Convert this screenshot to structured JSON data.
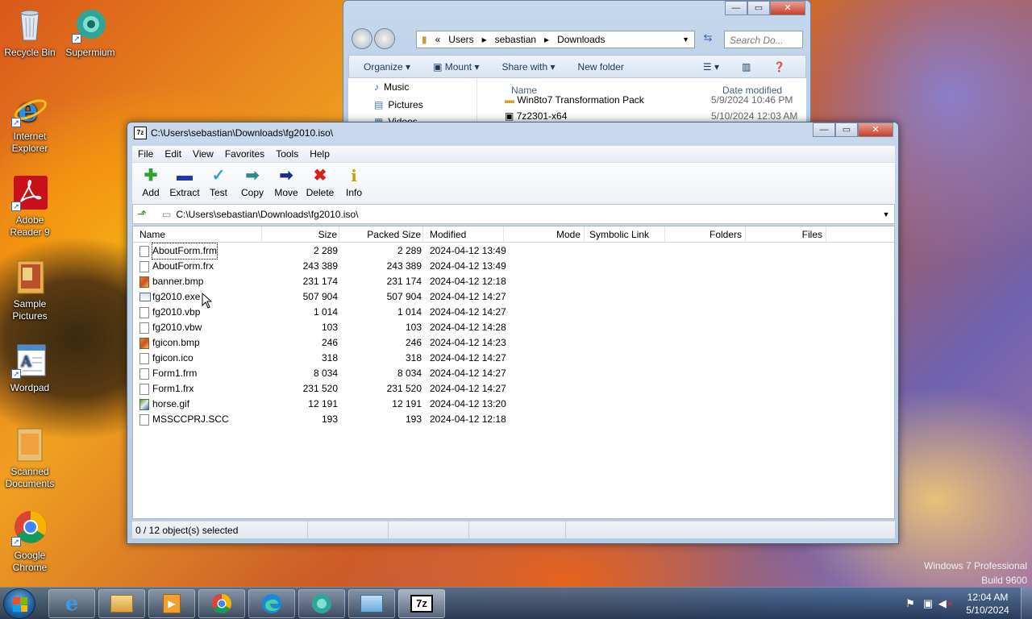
{
  "desktop": {
    "icons": [
      {
        "label": "Recycle Bin"
      },
      {
        "label": "Supermium"
      },
      {
        "label": "Internet Explorer"
      },
      {
        "label": "Adobe Reader 9"
      },
      {
        "label": "Sample Pictures"
      },
      {
        "label": "Wordpad"
      },
      {
        "label": "Scanned Documents"
      },
      {
        "label": "Google Chrome"
      }
    ],
    "watermark": {
      "line1": "Windows 7 Professional",
      "line2": "Build 9600"
    }
  },
  "explorer": {
    "address": {
      "part1": "Users",
      "part2": "sebastian",
      "part3": "Downloads",
      "prefix": "«"
    },
    "search_placeholder": "Search Do...",
    "toolbar": {
      "organize": "Organize",
      "mount": "Mount",
      "share": "Share with",
      "new_folder": "New folder"
    },
    "nav": [
      {
        "label": "Music"
      },
      {
        "label": "Pictures"
      },
      {
        "label": "Videos"
      }
    ],
    "columns": {
      "name": "Name",
      "date": "Date modified"
    },
    "rows": [
      {
        "name": "Win8to7 Transformation Pack",
        "date": "5/9/2024 10:46 PM"
      },
      {
        "name": "7z2301-x64",
        "date": "5/10/2024 12:03 AM"
      }
    ]
  },
  "zip": {
    "title": "C:\\Users\\sebastian\\Downloads\\fg2010.iso\\",
    "logo": "7z",
    "menu": [
      "File",
      "Edit",
      "View",
      "Favorites",
      "Tools",
      "Help"
    ],
    "toolbar": [
      {
        "label": "Add",
        "icon": "add-icon",
        "color": "#2aa52a"
      },
      {
        "label": "Extract",
        "icon": "extract-icon",
        "color": "#1a3aa8"
      },
      {
        "label": "Test",
        "icon": "test-icon",
        "color": "#2aa5c8"
      },
      {
        "label": "Copy",
        "icon": "copy-icon",
        "color": "#2a8a8a"
      },
      {
        "label": "Move",
        "icon": "move-icon",
        "color": "#1a2a8a"
      },
      {
        "label": "Delete",
        "icon": "delete-icon",
        "color": "#d82020"
      },
      {
        "label": "Info",
        "icon": "info-icon",
        "color": "#c8a000"
      }
    ],
    "path": "C:\\Users\\sebastian\\Downloads\\fg2010.iso\\",
    "columns": {
      "name": "Name",
      "size": "Size",
      "packed": "Packed Size",
      "modified": "Modified",
      "mode": "Mode",
      "symlink": "Symbolic Link",
      "folders": "Folders",
      "files": "Files"
    },
    "files": [
      {
        "name": "AboutForm.frm",
        "size": "2 289",
        "packed": "2 289",
        "modified": "2024-04-12 13:49",
        "type": "doc"
      },
      {
        "name": "AboutForm.frx",
        "size": "243 389",
        "packed": "243 389",
        "modified": "2024-04-12 13:49",
        "type": "doc"
      },
      {
        "name": "banner.bmp",
        "size": "231 174",
        "packed": "231 174",
        "modified": "2024-04-12 12:18",
        "type": "img"
      },
      {
        "name": "fg2010.exe",
        "size": "507 904",
        "packed": "507 904",
        "modified": "2024-04-12 14:27",
        "type": "exe"
      },
      {
        "name": "fg2010.vbp",
        "size": "1 014",
        "packed": "1 014",
        "modified": "2024-04-12 14:27",
        "type": "doc"
      },
      {
        "name": "fg2010.vbw",
        "size": "103",
        "packed": "103",
        "modified": "2024-04-12 14:28",
        "type": "doc"
      },
      {
        "name": "fgicon.bmp",
        "size": "246",
        "packed": "246",
        "modified": "2024-04-12 14:23",
        "type": "img"
      },
      {
        "name": "fgicon.ico",
        "size": "318",
        "packed": "318",
        "modified": "2024-04-12 14:27",
        "type": "doc"
      },
      {
        "name": "Form1.frm",
        "size": "8 034",
        "packed": "8 034",
        "modified": "2024-04-12 14:27",
        "type": "doc"
      },
      {
        "name": "Form1.frx",
        "size": "231 520",
        "packed": "231 520",
        "modified": "2024-04-12 14:27",
        "type": "doc"
      },
      {
        "name": "horse.gif",
        "size": "12 191",
        "packed": "12 191",
        "modified": "2024-04-12 13:20",
        "type": "gif"
      },
      {
        "name": "MSSCCPRJ.SCC",
        "size": "193",
        "packed": "193",
        "modified": "2024-04-12 12:18",
        "type": "doc"
      }
    ],
    "status": "0 / 12 object(s) selected"
  },
  "taskbar": {
    "clock_time": "12:04 AM",
    "clock_date": "5/10/2024",
    "apps": [
      "internet-explorer",
      "file-explorer",
      "media-player",
      "google-chrome",
      "microsoft-edge",
      "supermium",
      "control-panel",
      "7-zip"
    ],
    "active_label": "7z"
  }
}
